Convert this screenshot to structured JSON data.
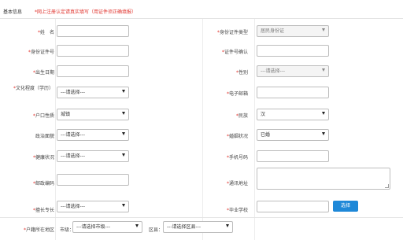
{
  "header": {
    "title": "基本信息",
    "notice": "*网上注册认定请真实填写（用证件须正确填报）"
  },
  "form": {
    "name_label": "姓　名",
    "id_type_label": "身份证件类型",
    "id_type_value": "居民身份证",
    "id_no_label": "身份证件号",
    "id_confirm_label": "证件号确认",
    "birth_label": "出生日期",
    "gender_label": "性别",
    "gender_value": "---请选择---",
    "edu_label": "文化程度（学历）",
    "edu_value": "---请选择---",
    "email_label": "电子邮箱",
    "hukou_label": "户口性质",
    "hukou_value": "城镇",
    "nation_label": "民族",
    "nation_value": "汉",
    "politics_label": "政治面貌",
    "politics_value": "---请选择---",
    "marriage_label": "婚姻状况",
    "marriage_value": "已婚",
    "health_label": "健康状况",
    "health_value": "---请选择---",
    "mobile_label": "手机号码",
    "postcode_label": "邮政编码",
    "address_label": "通讯地址",
    "specialty_label": "擅长专长",
    "specialty_value": "---请选择---",
    "school_label": "毕业学校",
    "choose_button": "选择",
    "hukou_loc_label": "户籍所在地区",
    "city_label": "市级：",
    "city_value": "---请选择市级---",
    "district_label": "区县：",
    "district_value": "---请选择区县---"
  }
}
